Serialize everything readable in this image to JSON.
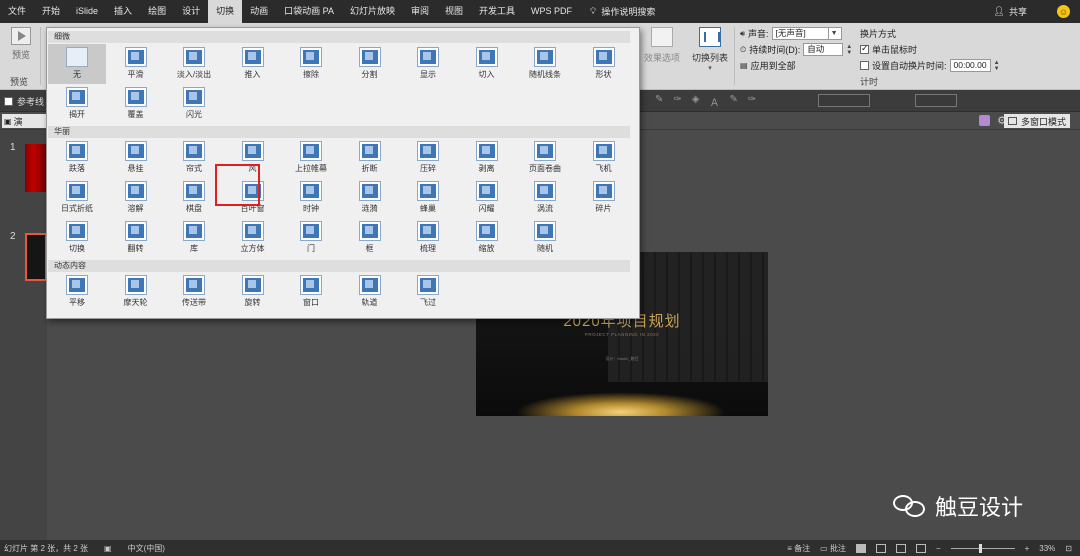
{
  "menubar": {
    "items": [
      "文件",
      "开始",
      "iSlide",
      "插入",
      "绘图",
      "设计",
      "切换",
      "动画",
      "口袋动画 PA",
      "幻灯片放映",
      "审阅",
      "视图",
      "开发工具",
      "WPS PDF"
    ],
    "active_index": 6,
    "search_label": "操作说明搜索",
    "share_label": "共享"
  },
  "ribbon": {
    "preview_label": "预览",
    "preview_group_label": "预览",
    "effect_options_label": "效果选项",
    "transition_list_label": "切换列表",
    "sound_label": "声音:",
    "sound_value": "[无声音]",
    "duration_label": "持续时间(D):",
    "duration_value": "自动",
    "apply_all_label": "应用到全部",
    "switch_mode_label": "换片方式",
    "on_click_label": "单击鼠标时",
    "on_click_checked": true,
    "auto_after_label": "设置自动换片时间:",
    "auto_after_checked": false,
    "auto_after_value": "00:00.00",
    "timing_group_label": "计时"
  },
  "toolstrip": {
    "ref_line_label": "参考线"
  },
  "tabstrip": {
    "doc_tab_label": "演",
    "multi_window_label": "多窗口模式"
  },
  "thumbnails": [
    "1",
    "2"
  ],
  "slide": {
    "title": "2020年项目规划",
    "subtitle": "PROJECT PLANNING IN 2020",
    "author": "设计：Martin_触豆"
  },
  "gallery": {
    "categories": [
      "细微",
      "华丽",
      "动态内容"
    ],
    "subtle": [
      "无",
      "平滑",
      "淡入/淡出",
      "推入",
      "擦除",
      "分割",
      "显示",
      "切入",
      "随机线条",
      "形状",
      "揭开",
      "覆盖",
      "闪光"
    ],
    "exciting": [
      "跌落",
      "悬挂",
      "帘式",
      "风",
      "上拉帷幕",
      "折断",
      "压碎",
      "剥离",
      "页面卷曲",
      "飞机",
      "日式折纸",
      "溶解",
      "棋盘",
      "百叶窗",
      "时钟",
      "涟漪",
      "蜂巢",
      "闪耀",
      "涡流",
      "碎片",
      "切换",
      "翻转",
      "库",
      "立方体",
      "门",
      "框",
      "梳理",
      "缩放",
      "随机"
    ],
    "dynamic": [
      "平移",
      "摩天轮",
      "传送带",
      "旋转",
      "窗口",
      "轨道",
      "飞过"
    ],
    "selected_label": "无",
    "highlighted_label": "帘式"
  },
  "watermark": {
    "text": "触豆设计"
  },
  "statusbar": {
    "slide_info": "幻灯片 第 2 张，共 2 张",
    "language": "中文(中国)",
    "notes_label": "备注",
    "comments_label": "批注",
    "zoom": "33%"
  }
}
